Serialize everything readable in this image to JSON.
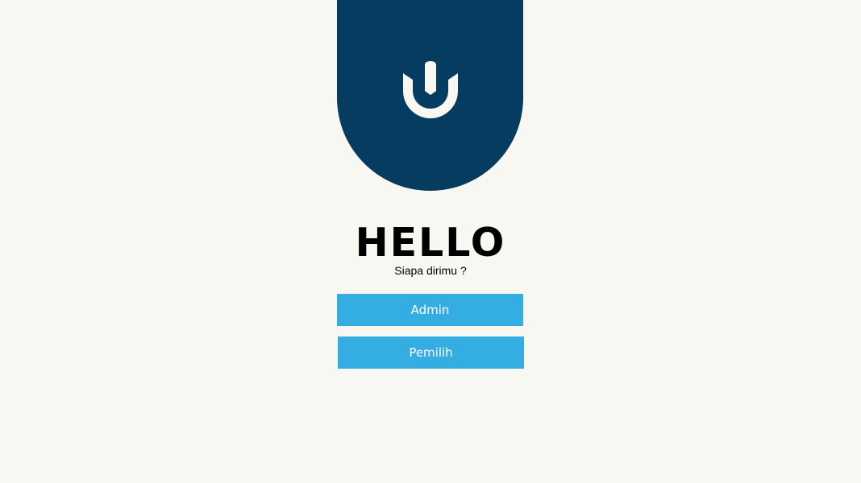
{
  "header": {
    "logo_icon": "anchor-u-logo-icon",
    "banner_color": "#073c61",
    "logo_color": "#f9f7f1"
  },
  "greeting": {
    "title": "HELLO",
    "subtitle": "Siapa dirimu ?"
  },
  "roles": {
    "admin_label": "Admin",
    "pemilih_label": "Pemilih",
    "button_color": "#34ade2",
    "button_text_color": "#ffffff"
  },
  "page": {
    "background": "#f9f7f1"
  }
}
